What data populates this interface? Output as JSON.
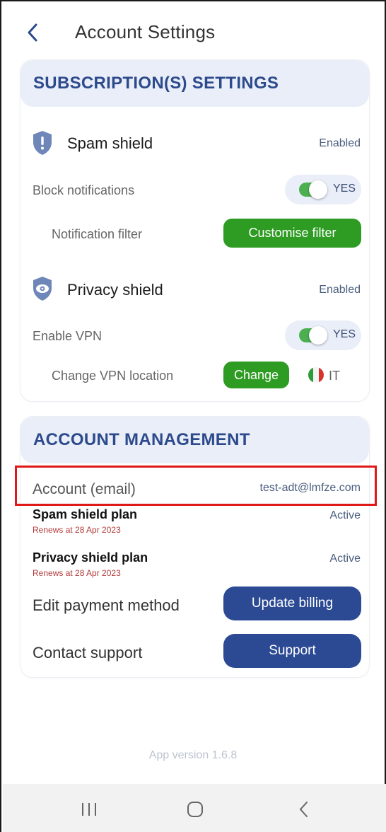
{
  "header": {
    "title": "Account Settings"
  },
  "subscriptions": {
    "title": "SUBSCRIPTION(S) SETTINGS",
    "spam": {
      "title": "Spam shield",
      "status": "Enabled",
      "block_label": "Block notifications",
      "block_toggle": "YES",
      "filter_label": "Notification filter",
      "filter_button": "Customise filter"
    },
    "privacy": {
      "title": "Privacy shield",
      "status": "Enabled",
      "vpn_label": "Enable VPN",
      "vpn_toggle": "YES",
      "location_label": "Change VPN location",
      "change_button": "Change",
      "country_code": "IT"
    }
  },
  "account": {
    "title": "ACCOUNT MANAGEMENT",
    "email_label": "Account (email)",
    "email_value": "test-adt@lmfze.com",
    "spam_plan": {
      "title": "Spam shield plan",
      "renews": "Renews at 28 Apr 2023",
      "status": "Active"
    },
    "privacy_plan": {
      "title": "Privacy shield plan",
      "renews": "Renews at 28 Apr 2023",
      "status": "Active"
    },
    "payment_label": "Edit payment method",
    "billing_button": "Update billing",
    "support_label": "Contact support",
    "support_button": "Support"
  },
  "footer": {
    "version": "App version 1.6.8"
  },
  "colors": {
    "brand_blue": "#2c4a8c",
    "button_blue": "#2c4a94",
    "green": "#2e9b22",
    "toggle_on": "#4caf50",
    "highlight_red": "#e01818"
  },
  "icons": [
    "back-arrow-icon",
    "shield-alert-icon",
    "shield-eye-icon",
    "italy-flag-icon",
    "recent-apps-icon",
    "home-icon",
    "nav-back-icon"
  ]
}
